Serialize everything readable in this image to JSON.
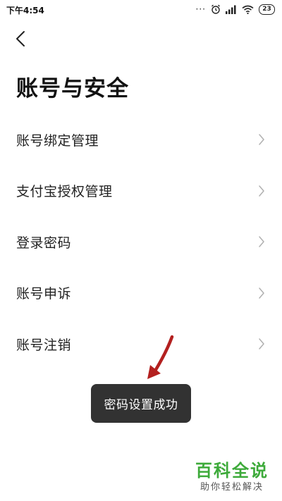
{
  "status_bar": {
    "time": "下午4:54",
    "dots": "···",
    "battery": "23"
  },
  "header": {
    "title": "账号与安全"
  },
  "menu": {
    "items": [
      {
        "label": "账号绑定管理"
      },
      {
        "label": "支付宝授权管理"
      },
      {
        "label": "登录密码"
      },
      {
        "label": "账号申诉"
      },
      {
        "label": "账号注销"
      }
    ]
  },
  "toast": {
    "text": "密码设置成功"
  },
  "watermark": {
    "main": "百科全说",
    "sub": "助你轻松解决"
  },
  "colors": {
    "background": "#ffffff",
    "toast_bg": "#323232",
    "arrow": "#b3201f",
    "watermark_green": "#3daa3a",
    "chevron": "#b0b0b0"
  },
  "icons": [
    "alarm-icon",
    "signal-icon",
    "wifi-icon",
    "battery-icon",
    "back-arrow-icon",
    "chevron-right-icon"
  ]
}
